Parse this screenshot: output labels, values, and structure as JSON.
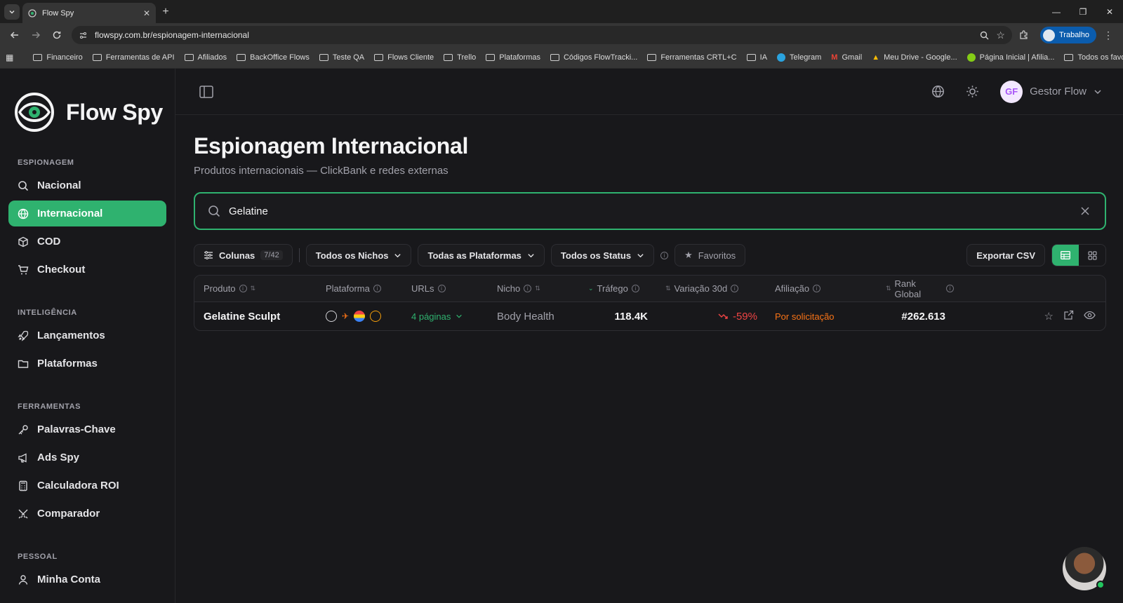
{
  "browser": {
    "tab_title": "Flow Spy",
    "url": "flowspy.com.br/espionagem-internacional",
    "profile": "Trabalho",
    "bookmarks": [
      "Financeiro",
      "Ferramentas de API",
      "Afiliados",
      "BackOffice Flows",
      "Teste QA",
      "Flows Cliente",
      "Trello",
      "Plataformas",
      "Códigos FlowTracki...",
      "Ferramentas CRTL+C",
      "IA",
      "Telegram",
      "Gmail",
      "Meu Drive - Google...",
      "Página Inicial | Afilia..."
    ],
    "all_bookmarks": "Todos os favoritos"
  },
  "app": {
    "name": "Flow Spy",
    "colors": {
      "accent": "#2fb26f",
      "negative": "#ef4444",
      "warning": "#f97316"
    }
  },
  "sidebar": {
    "sections": [
      {
        "title": "ESPIONAGEM",
        "items": [
          {
            "label": "Nacional",
            "icon": "search-icon"
          },
          {
            "label": "Internacional",
            "icon": "globe-icon",
            "active": true
          },
          {
            "label": "COD",
            "icon": "box-icon"
          },
          {
            "label": "Checkout",
            "icon": "cart-icon"
          }
        ]
      },
      {
        "title": "INTELIGÊNCIA",
        "items": [
          {
            "label": "Lançamentos",
            "icon": "rocket-icon"
          },
          {
            "label": "Plataformas",
            "icon": "folder-icon"
          }
        ]
      },
      {
        "title": "FERRAMENTAS",
        "items": [
          {
            "label": "Palavras-Chave",
            "icon": "key-icon"
          },
          {
            "label": "Ads Spy",
            "icon": "megaphone-icon"
          },
          {
            "label": "Calculadora ROI",
            "icon": "calculator-icon"
          },
          {
            "label": "Comparador",
            "icon": "swords-icon"
          }
        ]
      },
      {
        "title": "PESSOAL",
        "items": [
          {
            "label": "Minha Conta",
            "icon": "user-icon"
          }
        ]
      }
    ]
  },
  "topbar": {
    "user_initials": "GF",
    "user_name": "Gestor Flow"
  },
  "page": {
    "title": "Espionagem Internacional",
    "subtitle": "Produtos internacionais — ClickBank e redes externas"
  },
  "search": {
    "value": "Gelatine"
  },
  "filters": {
    "columns_label": "Colunas",
    "columns_count": "7/42",
    "niches": "Todos os Nichos",
    "platforms": "Todas as Plataformas",
    "status": "Todos os Status",
    "favorites": "Favoritos",
    "export": "Exportar CSV"
  },
  "table": {
    "headers": [
      "Produto",
      "Plataforma",
      "URLs",
      "Nicho",
      "Tráfego",
      "Variação 30d",
      "Afiliação",
      "Rank Global"
    ],
    "rows": [
      {
        "product": "Gelatine Sculpt",
        "urls": "4 páginas",
        "niche": "Body Health",
        "traffic": "118.4K",
        "variation": "-59%",
        "affiliation": "Por solicitação",
        "rank": "#262.613"
      }
    ]
  }
}
